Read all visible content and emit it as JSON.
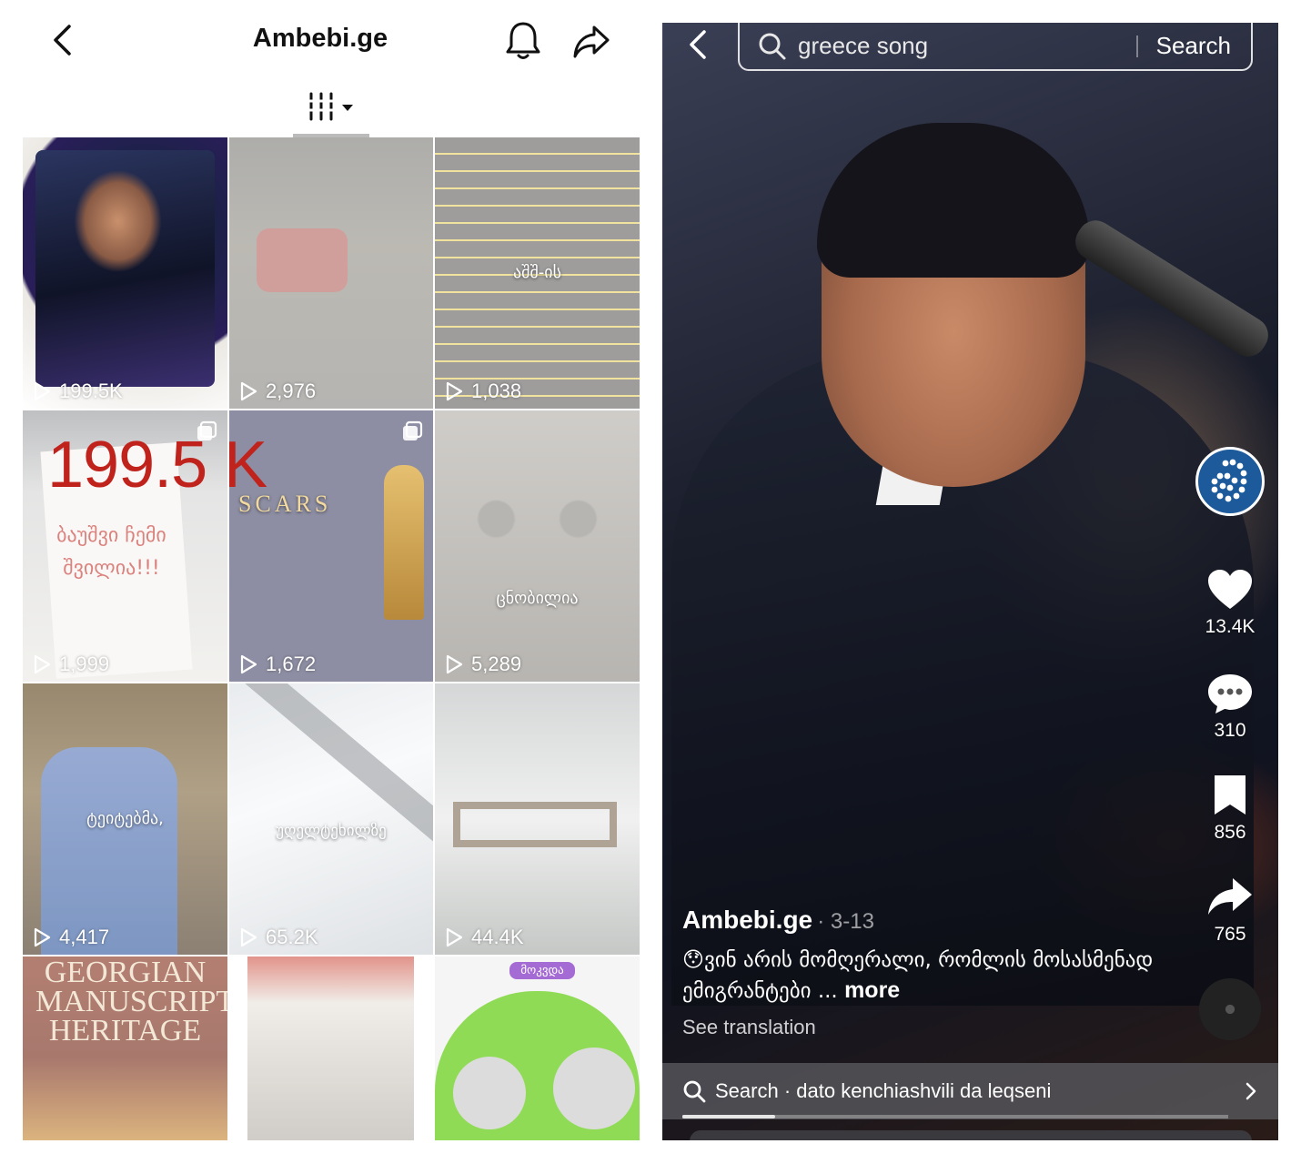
{
  "left": {
    "title": "Ambebi.ge",
    "icons": {
      "back": "chevron-left-icon",
      "bell": "bell-icon",
      "share": "share-arrow-icon",
      "filter": "filter-columns-icon"
    },
    "big_overlay_views": "199.5 K",
    "tiles": [
      {
        "views": "199.5K",
        "text": ""
      },
      {
        "views": "2,976",
        "text": ""
      },
      {
        "views": "1,038",
        "text": "აშშ-ის"
      },
      {
        "views": "1,999",
        "text": "ბაუშვი ჩემი შვილია!!!"
      },
      {
        "views": "1,672",
        "text": "SCARS"
      },
      {
        "views": "5,289",
        "text": "ცნობილია"
      },
      {
        "views": "4,417",
        "text": "ტეიტებმა,"
      },
      {
        "views": "65.2K",
        "text": "უღელტეხილზე"
      },
      {
        "views": "44.4K",
        "text": ""
      },
      {
        "views": "",
        "text": "GEORGIAN MANUSCRIPT HERITAGE"
      },
      {
        "views": "",
        "text": ""
      },
      {
        "views": "",
        "text": "მოკვდა"
      }
    ]
  },
  "right": {
    "search": {
      "query": "greece song",
      "button": "Search"
    },
    "actions": {
      "likes": "13.4K",
      "comments": "310",
      "saves": "856",
      "shares": "765"
    },
    "caption": {
      "author": "Ambebi.ge",
      "date": "· 3-13",
      "emoji": "😯",
      "text": "ვინ არის მომღერალი, რომლის მოსასმენად ემიგრანტები ...",
      "more": "more",
      "see_translation": "See translation"
    },
    "bottom_search": "Search · dato kenchiashvili da leqseni",
    "progress_fraction": 0.17
  }
}
